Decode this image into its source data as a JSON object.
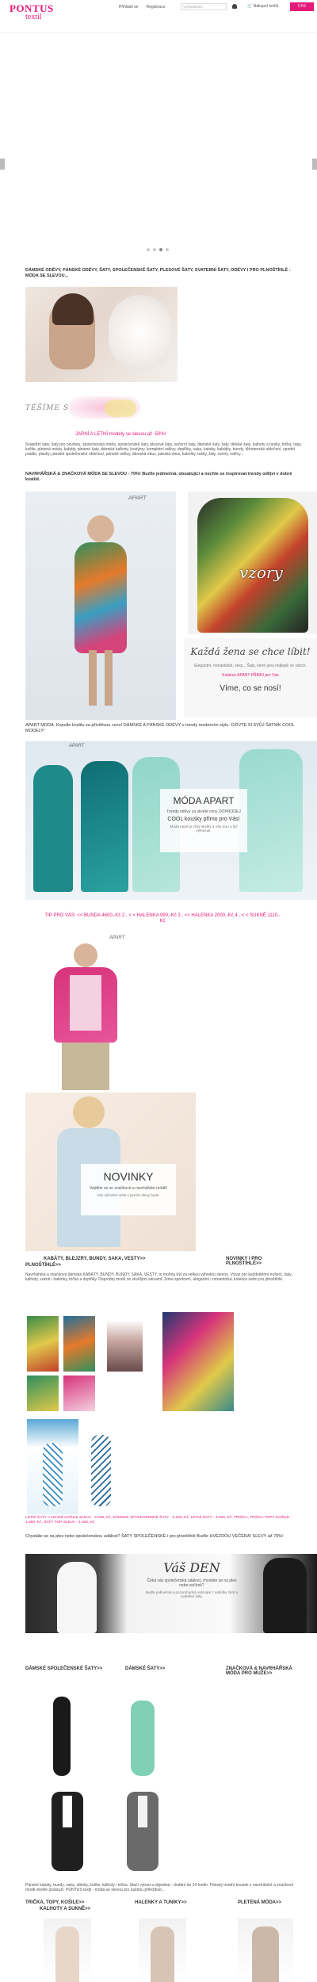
{
  "header": {
    "logo_main": "PONTUS",
    "logo_sub": "textil",
    "nav": [
      "Přihlásit se",
      "Registrace"
    ],
    "search_placeholder": "Vyhledávání",
    "cart_label": "Nákupní košík",
    "button_label": "0 Kč"
  },
  "intro": {
    "heading": "DÁMSKÉ ODĚVY, PÁNSKÉ ODĚVY, ŠATY, SPOLEČENSKÉ ŠATY, PLESOVÉ ŠATY, SVATEBNÍ ŠATY, ODĚVY I PRO PLNOŠTÍHLÉ - MÓDA SE SLEVOU...",
    "tesime_se": "TĚŠÍME SE",
    "promo": "JARNÍ A LETNÍ modely se slevou až -50%!",
    "body": "Svatební šaty, šaty pro nevěstu, společenská móda, společenské šaty, plesové šaty, večerní šaty, dámské šaty, šaty, dětské šaty, kalhoty a tuniky, trička, topy, košile, pletená móda, kabáty, pletené šaty, dámské kalhoty, kostýmy, kompletní oděvy, doplňky, saka, kabáty, kabátky, bundy, těhotenské oblečení, spodní prádlo, plavky, pánské společenské oblečení, pánské oděvy, dámská obuv, pánská obuv, kabelky, tašky, šály, svetry, oděvy...",
    "slogan": "NAVRHÁŘSKÁ & ZNAČKOVÁ MÓDA SE SLEVOU - 70%! Buďte jedinečná, obsažující a nechte se inspirovat trendy odějví v dobré kvalitě."
  },
  "banner1": {
    "brand": "APART",
    "vzory": "vzory",
    "tagline": "Každá žena se chce líbit!",
    "sub": "Elegantní, romantické, sexy... Šaty, které jsou nejlepší ze všech.",
    "link": "Kolekce APART PŘÍMO pro Vás",
    "cta": "Víme, co se nosí!"
  },
  "apart_text": "APART MODA. Kopulte kvalitu za přívětivou cenu! DÁMSKÉ A PÁNSKÉ ODĚVY v trendy moderním stylu. OŽIVTE SI SVŮJ ŠATNÍK COOL MODELY!",
  "banner2": {
    "brand": "APART",
    "title": "MÓDA APART",
    "sub1": "Trendy oděvy za skvělé ceny DOPRODEJ",
    "sub2": "COOL kousky přímo pro Vás!",
    "sub3": "Móda Apart je vždy skvělý a Vás jsou a byl vyhovuje."
  },
  "deals": "TIP PRO VÁS: << BUNDA 4600,-Kč 2 , < < HALENKA 990,-Kč 3 , << HALENKA 2000,-Kč 4 , < < SUKNĚ 1110,-Kč",
  "novinky": {
    "brand": "APART",
    "title": "NOVINKY",
    "sub": "Vejděte se ve značkové a navrhářské módě!",
    "sub2": "Vás výhodné stále s jarními slevy bude."
  },
  "categories1": {
    "left": "KABÁTY, BLEJZRY, BUNDY, SAKA, VESTY>>",
    "right": "NOVINKY I PRO PLNOŠTÍHLÉ>>",
    "left2": "PLNOŠTÍHLÉ>>",
    "body": "Navrhářská a značková dámská KABÁTY, BUNDY, BUNDY, SAKA, VESTY, to mohou být za velkou výhodou slevou. Výraz pro každodenní nošení, šaty, kalhoty, sukně i halenky, trička a doplňky. Doprodej modů se skvělými slevami! Jsme sportovní, elegantní i romantická, kolekce nebo pro plnoštíhlé."
  },
  "links_row": "LETNÍ ŠATY A LEHKÉ KOŠILE SLEVA - 3.200,-Kč, DÁMSKÉ SPOLEČENSKÉ ŠATY - 2.200,-Kč, LETNÍ ŠATY - 3.200,-Kč, TRIČKA, TRIČKA TOPY KOŠILE - 1.890,-Kč, ŠATY TOP-SLEVA - 1.600,-Kč",
  "wedding": {
    "question": "Chystáte se na ples nebo společenskou událost? ŠATY SPOLEČENSKÉ i pro plnoštíhlé Buďte HVĚZDOU VEČERA! SLEVY až 70%!",
    "title": "Váš DEN",
    "sub": "Čeká vás společenská událost, chystáte se na ples nebo večírek?",
    "sub2": "Buďte jedinečná a pozoruhodná vybírejte z nabídky šatů a svatební šaty."
  },
  "categories2": {
    "c1": "DÁMSKÉ SPOLEČENSKÉ ŠATY>>",
    "c2": "DÁMSKÉ ŠATY>>",
    "c3": "ZNAČKOVÁ & NAVRHÁŘSKÁ MÓDA PRO MUŽE>>"
  },
  "footer_text": "Pánské kabáty, bundy, saka, obleky, košile, kalhoty i trička. Stačí vybrat a objednat - dodání do 24 hodin. Pánský módní kousek v navrhářské a značkové módě skvěle poslouží. PONTUS textil - móda se slevou pro každou příležitost...",
  "categories3": {
    "c1": "TRIČKA, TOPY, KOŠILE>>",
    "c1b": "KALHOTY A SUKNĚ>>",
    "c2": "HALENKY A TUNIKY>>",
    "c3": "PLETENÁ MÓDA>>"
  },
  "colors": {
    "accent": "#e5197a"
  }
}
